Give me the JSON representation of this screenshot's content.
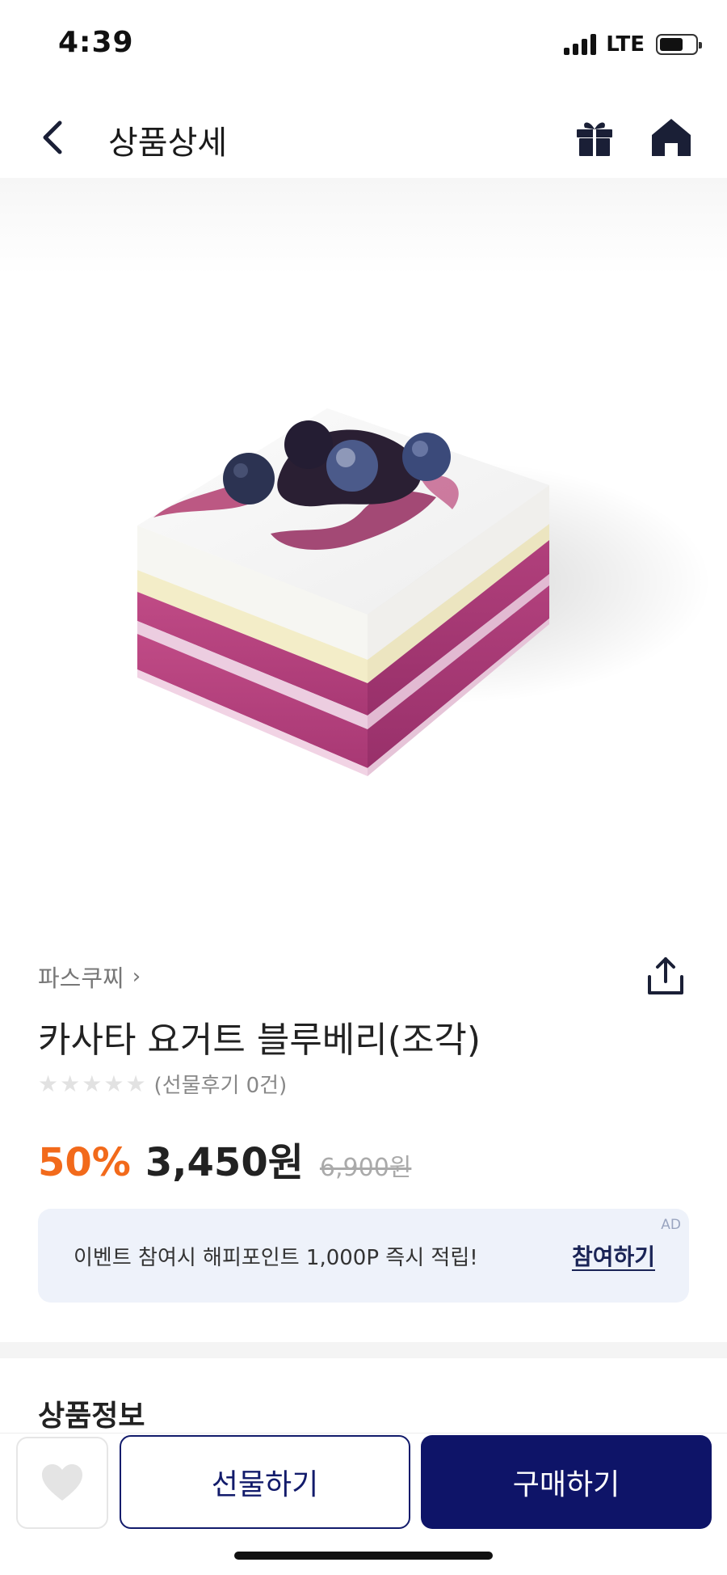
{
  "status_bar": {
    "time": "4:39",
    "network": "LTE"
  },
  "header": {
    "title": "상품상세"
  },
  "product": {
    "brand": "파스쿠찌",
    "name": "카사타 요거트 블루베리(조각)",
    "rating_stars": 0,
    "review_text": "(선물후기 0건)",
    "discount": "50%",
    "price": "3,450원",
    "original_price": "6,900원"
  },
  "event": {
    "text": "이벤트 참여시 해피포인트 1,000P 즉시 적립!",
    "action": "참여하기",
    "badge": "AD"
  },
  "section": {
    "title": "상품정보"
  },
  "bottom_bar": {
    "gift_label": "선물하기",
    "buy_label": "구매하기"
  },
  "colors": {
    "accent": "#0e1468",
    "discount": "#f26a1b",
    "banner_bg": "#eef2fa"
  }
}
